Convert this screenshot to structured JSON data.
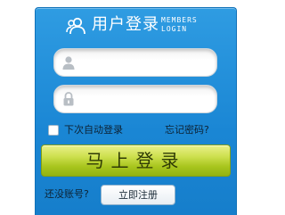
{
  "header": {
    "icon": "users-icon",
    "title": "用户登录",
    "title_en_line1": "MEMBERS",
    "title_en_line2": "LOGIN"
  },
  "form": {
    "username_icon": "person-icon",
    "username_value": "",
    "password_icon": "lock-icon",
    "password_value": "",
    "remember_checked": false,
    "remember_label": "下次自动登录",
    "forgot_link": "忘记密码?"
  },
  "actions": {
    "login_label": "马上登录",
    "no_account_label": "还没账号?",
    "register_label": "立即注册"
  },
  "colors": {
    "panel_blue": "#1f8cd8",
    "login_green": "#b6ce2a"
  }
}
